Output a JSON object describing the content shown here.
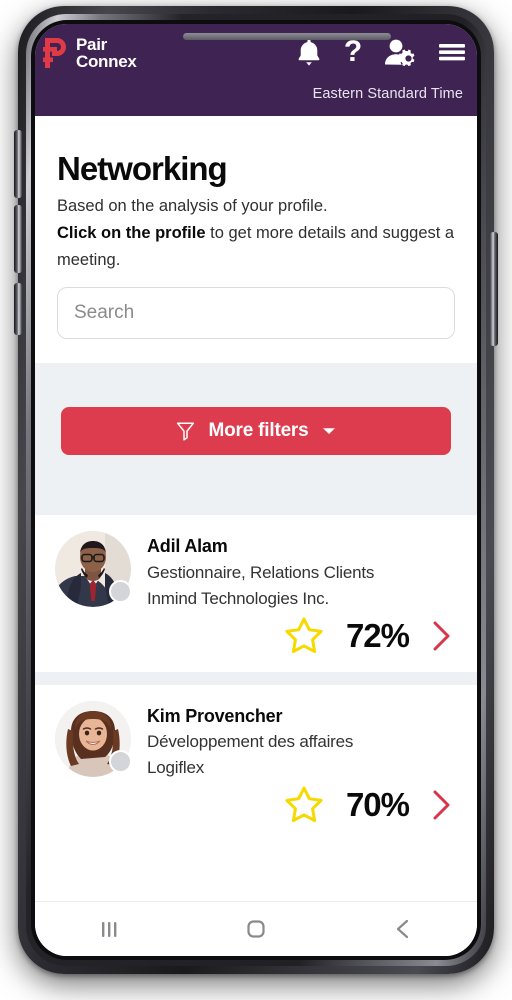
{
  "header": {
    "logo": {
      "mark": "paircconnex-logo-mark",
      "line1": "Pair",
      "line2": "Connex",
      "mark_color": "#e03a46"
    },
    "icons": [
      {
        "name": "notifications-bell-icon",
        "glyph": "bell"
      },
      {
        "name": "help-question-icon",
        "glyph": "question-mark"
      },
      {
        "name": "profile-settings-icon",
        "glyph": "user-gear"
      },
      {
        "name": "hamburger-menu-icon",
        "glyph": "hamburger"
      }
    ],
    "timezone": "Eastern Standard Time",
    "background_color": "#3f2353"
  },
  "intro": {
    "title": "Networking",
    "line1": "Based on the analysis of your profile.",
    "line2_strong": "Click on the profile",
    "line2_rest": " to get more details and suggest a meeting."
  },
  "search": {
    "placeholder": "Search",
    "value": ""
  },
  "filters": {
    "label": "More filters",
    "funnel_icon": "funnel-icon",
    "caret_icon": "chevron-down-icon",
    "color": "#dc3c4d"
  },
  "profiles": [
    {
      "name": "Adil Alam",
      "role": "Gestionnaire, Relations Clients",
      "company": "Inmind Technologies Inc.",
      "match": "72%",
      "starred": false,
      "status": "offline",
      "avatar": "man-in-suit-with-glasses"
    },
    {
      "name": "Kim Provencher",
      "role": "Développement des affaires",
      "company": "Logiflex",
      "match": "70%",
      "starred": false,
      "status": "offline",
      "avatar": "woman-with-brown-hair-smiling"
    }
  ],
  "colors": {
    "star": "#f7d900",
    "chevron": "#d9344a",
    "band": "#eef1f3"
  },
  "android_nav": {
    "recents": "recents-button",
    "home": "home-button",
    "back": "back-button"
  }
}
